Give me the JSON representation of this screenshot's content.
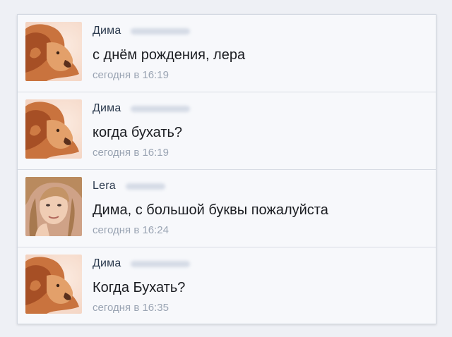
{
  "messages": [
    {
      "sender": "Дима",
      "text": "с днём рождения, лера",
      "time": "сегодня в 16:19",
      "avatar_icon": "lion-avatar-icon"
    },
    {
      "sender": "Дима",
      "text": "когда бухать?",
      "time": "сегодня в 16:19",
      "avatar_icon": "lion-avatar-icon"
    },
    {
      "sender": "Lera",
      "text": "Дима, с большой буквы пожалуйста",
      "time": "сегодня в 16:24",
      "avatar_icon": "girl-avatar-icon"
    },
    {
      "sender": "Дима",
      "text": "Когда Бухать?",
      "time": "сегодня в 16:35",
      "avatar_icon": "lion-avatar-icon"
    }
  ],
  "colors": {
    "page_background": "#eef0f5",
    "panel_background": "#f7f8fb",
    "name": "#2b3a4e",
    "time": "#9aa4b3",
    "divider": "#d8dce4"
  }
}
